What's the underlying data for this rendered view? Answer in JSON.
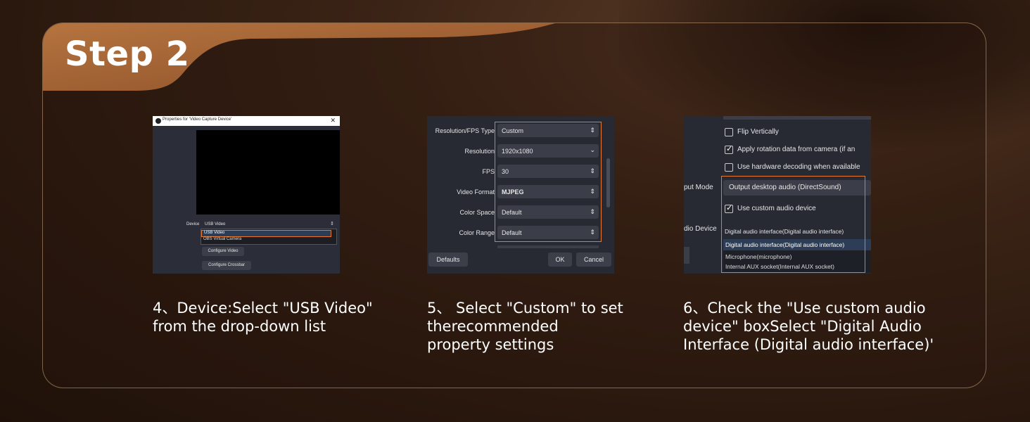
{
  "header": {
    "title": "Step 2"
  },
  "colors": {
    "accent": "#e9782b",
    "leather": "#a9693c",
    "panel_border": "#cda57d"
  },
  "steps": [
    {
      "caption": "4、Device:Select \"USB Video\"\nfrom the drop-down list",
      "screenshot": {
        "window_title": "Properties for 'Video Capture Device'",
        "close_glyph": "✕",
        "device_label": "Device",
        "device_value": "USB Video",
        "options": [
          "USB Video",
          "OBS Virtual Camera"
        ],
        "buttons": [
          "Configure Video",
          "Configure Crossbar"
        ]
      }
    },
    {
      "caption": "5、 Select \"Custom\" to set\ntherecommended\nproperty settings",
      "screenshot": {
        "rows": [
          {
            "label": "Resolution/FPS Type",
            "value": "Custom"
          },
          {
            "label": "Resolution",
            "value": "1920x1080"
          },
          {
            "label": "FPS",
            "value": "30"
          },
          {
            "label": "Video Format",
            "value": "MJPEG"
          },
          {
            "label": "Color Space",
            "value": "Default"
          },
          {
            "label": "Color Range",
            "value": "Default"
          }
        ],
        "defaults_button": "Defaults",
        "ok_button": "OK",
        "cancel_button": "Cancel"
      }
    },
    {
      "caption": "6、Check the \"Use custom audio\ndevice\" boxSelect \"Digital Audio\nInterface (Digital audio interface)'",
      "screenshot": {
        "checkboxes": [
          {
            "label": "Flip Vertically",
            "checked": false
          },
          {
            "label": "Apply rotation data from camera (if an",
            "checked": true
          },
          {
            "label": "Use hardware decoding when available",
            "checked": false
          }
        ],
        "output_mode_label": "put Mode",
        "output_mode_value": "Output desktop audio (DirectSound)",
        "custom_audio_label": "Use custom audio device",
        "audio_device_label": "dio Device",
        "audio_device_value": "Digital audio interface(Digital audio interface)",
        "options": [
          "Digital audio interface(Digital audio interface)",
          "Microphone(microphone)",
          "Internal AUX socket(Internal AUX socket)"
        ]
      }
    }
  ]
}
